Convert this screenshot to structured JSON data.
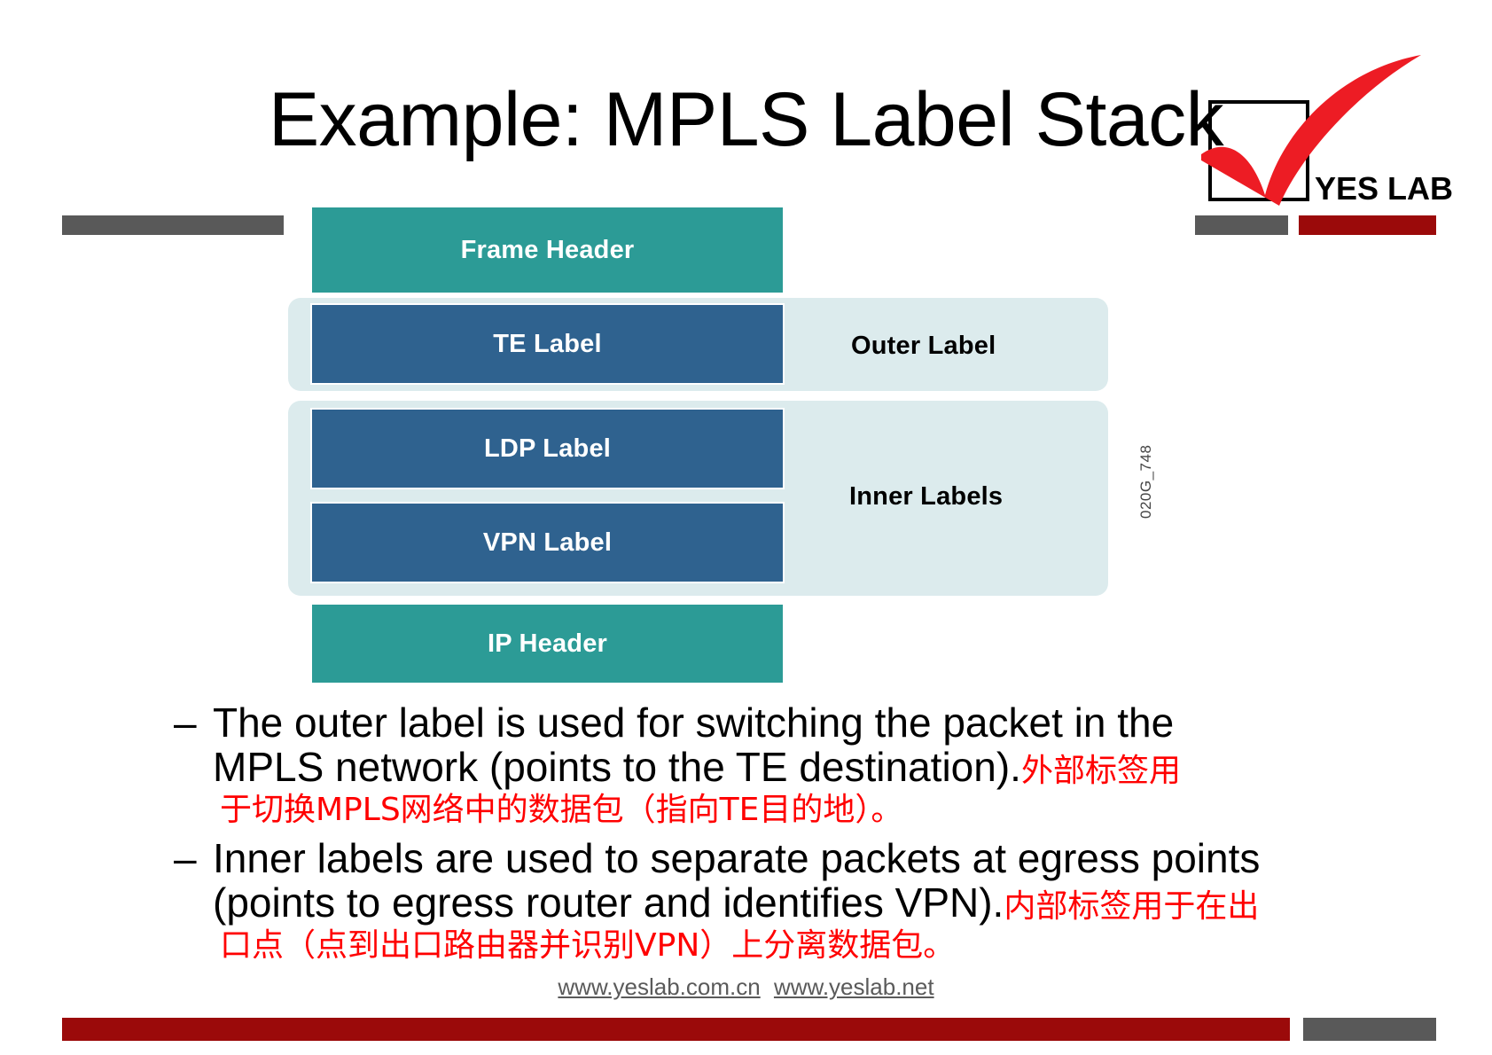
{
  "slide": {
    "title": "Example: MPLS Label Stack",
    "reference_code": "020G_748"
  },
  "logo": {
    "name": "yes-lab-logo",
    "text": "YES LAB",
    "check_color": "#ed1c24",
    "box_color": "#000000"
  },
  "decor": {
    "grey": "#595959",
    "red": "#9b0a0a"
  },
  "diagram": {
    "type": "stack",
    "blocks": [
      {
        "label": "Frame Header",
        "color": "#2c9b96",
        "style": "teal"
      },
      {
        "label": "TE Label",
        "color": "#2f628f",
        "style": "blue"
      },
      {
        "label": "LDP Label",
        "color": "#2f628f",
        "style": "blue"
      },
      {
        "label": "VPN Label",
        "color": "#2f628f",
        "style": "blue"
      },
      {
        "label": "IP Header",
        "color": "#2c9b96",
        "style": "teal"
      }
    ],
    "groups": [
      {
        "label": "Outer Label",
        "members": [
          "TE Label"
        ],
        "background": "#dcebed"
      },
      {
        "label": "Inner Labels",
        "members": [
          "LDP Label",
          "VPN Label"
        ],
        "background": "#dcebed"
      }
    ]
  },
  "bullets": [
    {
      "marker": "–",
      "line1": "The outer label is used for switching the packet in the",
      "line2": "MPLS network (points to the TE destination).",
      "zh_inline": "外部标签用",
      "zh_next": "于切换MPLS网络中的数据包（指向TE目的地）。"
    },
    {
      "marker": "–",
      "line1": "Inner labels are used to separate packets at egress points",
      "line2": "(points to egress router and identifies VPN).",
      "zh_inline": "内部标签用于在出",
      "zh_next": "口点（点到出口路由器并识别VPN）上分离数据包。"
    }
  ],
  "footer": {
    "link1": "www.yeslab.com.cn",
    "link2": "www.yeslab.net"
  }
}
